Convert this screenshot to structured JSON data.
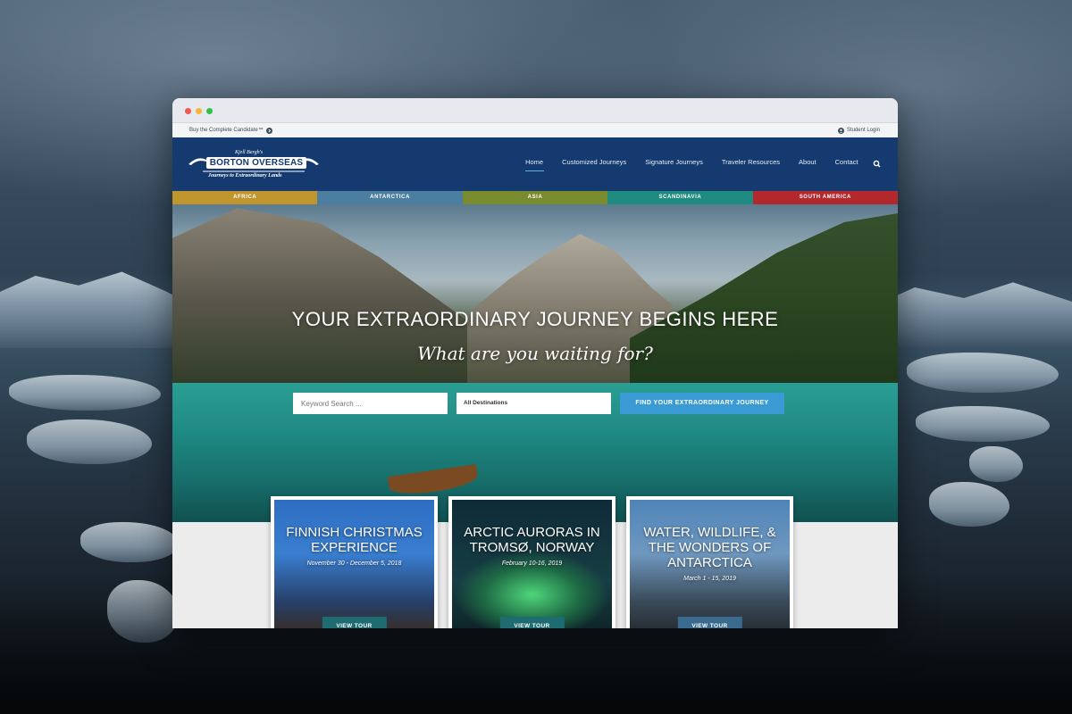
{
  "colors": {
    "header": "#153a6f",
    "accent": "#3a9ad4",
    "teal_button": "#1f6b72"
  },
  "utility_bar": {
    "promo_link": "Buy the Complete Candidate™",
    "login_link": "Student Login"
  },
  "logo": {
    "small_text": "Kjell Bergh's",
    "name": "BORTON OVERSEAS",
    "tagline": "Journeys to Extraordinary Lands"
  },
  "nav": {
    "items": [
      {
        "label": "Home",
        "active": true
      },
      {
        "label": "Customized Journeys"
      },
      {
        "label": "Signature Journeys"
      },
      {
        "label": "Traveler Resources"
      },
      {
        "label": "About"
      },
      {
        "label": "Contact"
      }
    ],
    "search_icon": "search-icon"
  },
  "regions": [
    {
      "label": "AFRICA",
      "color": "#c0952e"
    },
    {
      "label": "ANTARCTICA",
      "color": "#4b7ea0"
    },
    {
      "label": "ASIA",
      "color": "#7a8a2e"
    },
    {
      "label": "SCANDINAVIA",
      "color": "#1f8a80"
    },
    {
      "label": "SOUTH AMERICA",
      "color": "#b3282d"
    }
  ],
  "hero": {
    "headline": "YOUR EXTRAORDINARY JOURNEY BEGINS HERE",
    "subheadline": "What are you waiting for?",
    "keyword_placeholder": "Keyword Search ...",
    "destination_selected": "All Destinations",
    "find_button": "FIND YOUR EXTRAORDINARY JOURNEY"
  },
  "tours": [
    {
      "title": "FINNISH CHRISTMAS EXPERIENCE",
      "date": "November 30 - December 5, 2018",
      "button": "VIEW TOUR",
      "button_color": "#1f6b72"
    },
    {
      "title": "ARCTIC AURORAS IN TROMSØ, NORWAY",
      "date": "February 10-16, 2019",
      "button": "VIEW TOUR",
      "button_color": "#1f6b72"
    },
    {
      "title": "WATER, WILDLIFE, & THE WONDERS OF ANTARCTICA",
      "date": "March 1 - 15, 2019",
      "button": "VIEW TOUR",
      "button_color": "#3a6a8e"
    }
  ]
}
